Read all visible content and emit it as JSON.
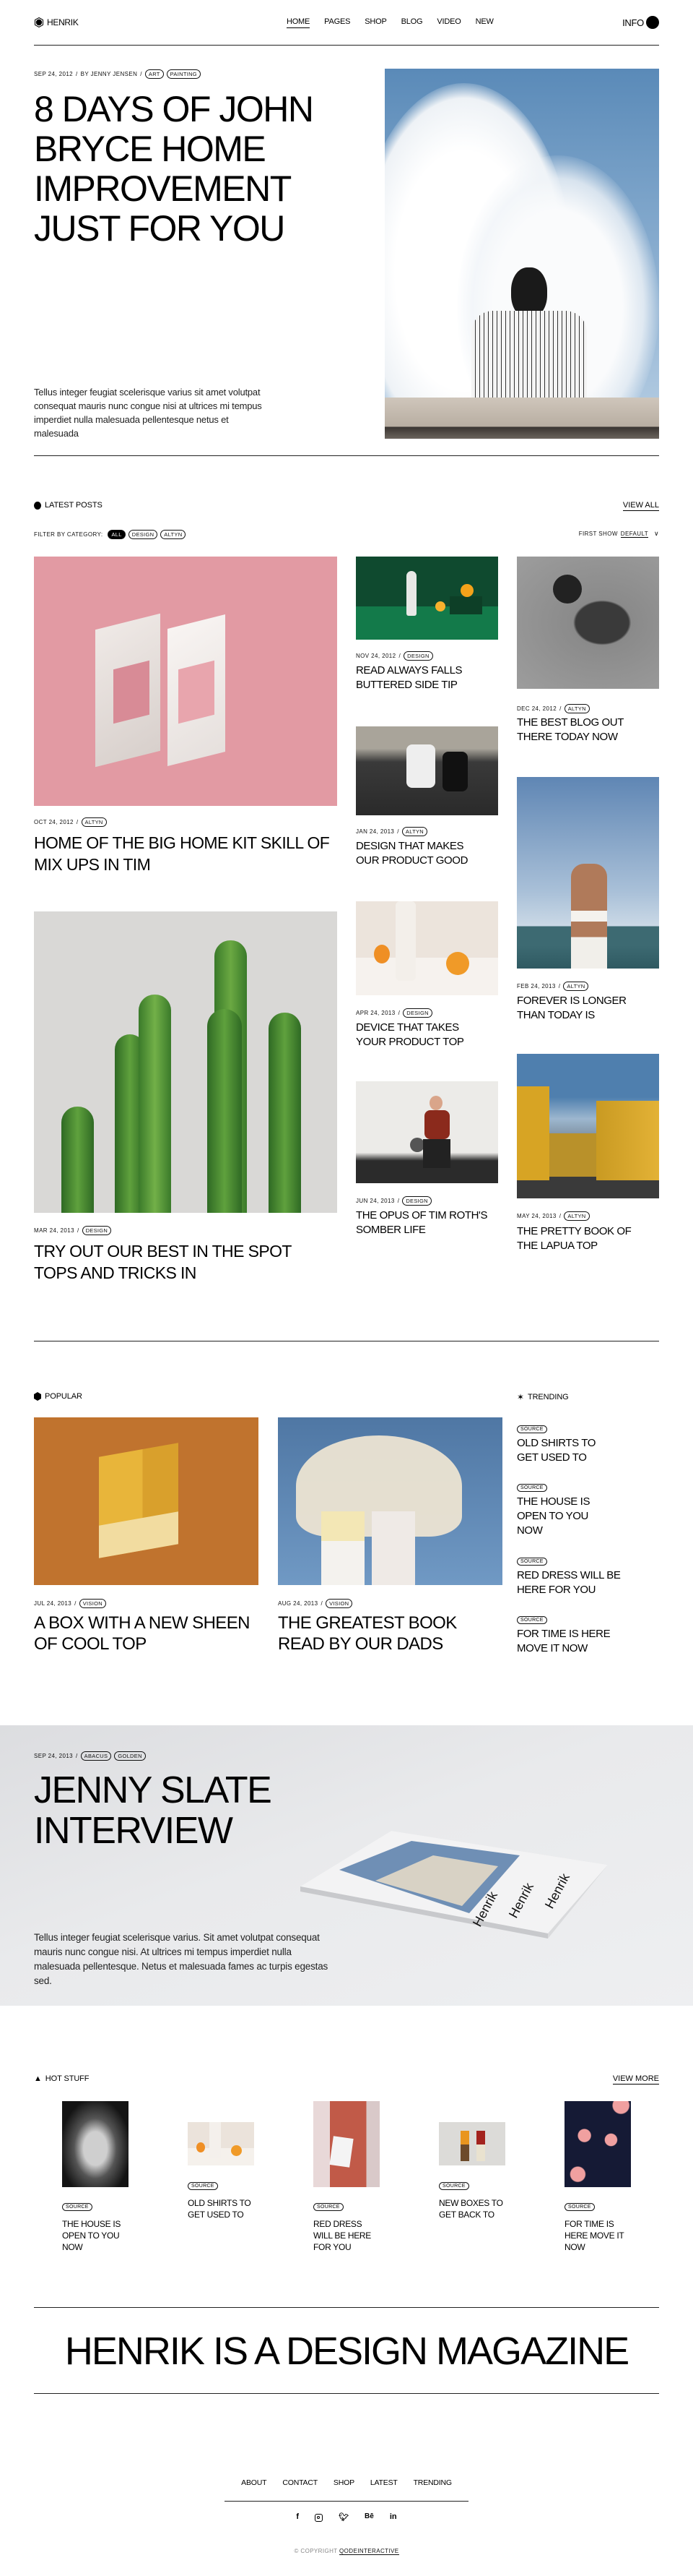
{
  "nav": {
    "logo": "HENRIK",
    "items": [
      "HOME",
      "PAGES",
      "SHOP",
      "BLOG",
      "VIDEO",
      "NEW"
    ],
    "info": "INFO"
  },
  "hero": {
    "date": "SEP 24, 2012",
    "author": "BY JENNY JENSEN",
    "tags": [
      "ART",
      "PAINTING"
    ],
    "title": "8 DAYS OF JOHN BRYCE HOME IMPROVEMENT JUST FOR YOU",
    "excerpt": "Tellus integer feugiat scelerisque varius sit amet volutpat consequat mauris nunc congue nisi at ultrices mi tempus imperdiet nulla malesuada pellentesque netus et malesuada"
  },
  "latest": {
    "heading": "LATEST POSTS",
    "view_all": "VIEW ALL",
    "filter_label": "FILTER BY CATEGORY:",
    "filters": [
      "ALL",
      "DESIGN",
      "ALTYN"
    ],
    "sort_label": "FIRST SHOW",
    "sort_value": "DEFAULT",
    "posts": [
      {
        "date": "OCT 24, 2012",
        "tag": "ALTYN",
        "title": "HOME OF THE BIG HOME KIT SKILL OF MIX UPS IN TIM"
      },
      {
        "date": "NOV 24, 2012",
        "tag": "DESIGN",
        "title": "READ ALWAYS FALLS BUTTERED SIDE TIP"
      },
      {
        "date": "DEC 24, 2012",
        "tag": "ALTYN",
        "title": "THE BEST BLOG OUT THERE TODAY NOW"
      },
      {
        "date": "JAN 24, 2013",
        "tag": "ALTYN",
        "title": "DESIGN THAT MAKES OUR PRODUCT GOOD"
      },
      {
        "date": "FEB 24, 2013",
        "tag": "ALTYN",
        "title": "FOREVER IS LONGER THAN TODAY IS"
      },
      {
        "date": "MAR 24, 2013",
        "tag": "DESIGN",
        "title": "TRY OUT OUR BEST IN THE SPOT TOPS AND TRICKS IN"
      },
      {
        "date": "APR 24, 2013",
        "tag": "DESIGN",
        "title": "DEVICE THAT TAKES YOUR PRODUCT TOP"
      },
      {
        "date": "JUN 24, 2013",
        "tag": "DESIGN",
        "title": "THE OPUS OF TIM ROTH'S SOMBER LIFE"
      },
      {
        "date": "MAY 24, 2013",
        "tag": "ALTYN",
        "title": "THE PRETTY BOOK OF THE LAPUA TOP"
      }
    ]
  },
  "popular": {
    "heading": "POPULAR",
    "posts": [
      {
        "date": "JUL 24, 2013",
        "tag": "VISION",
        "title": "A BOX WITH A NEW SHEEN OF COOL TOP"
      },
      {
        "date": "AUG 24, 2013",
        "tag": "VISION",
        "title": "THE GREATEST BOOK READ BY OUR DADS"
      }
    ]
  },
  "trending": {
    "heading": "TRENDING",
    "items": [
      {
        "tag": "SOURCE",
        "title": "OLD SHIRTS TO GET USED TO"
      },
      {
        "tag": "SOURCE",
        "title": "THE HOUSE IS OPEN TO YOU NOW"
      },
      {
        "tag": "SOURCE",
        "title": "RED DRESS WILL BE HERE FOR YOU"
      },
      {
        "tag": "SOURCE",
        "title": "FOR TIME IS HERE MOVE IT NOW"
      }
    ]
  },
  "interview": {
    "date": "SEP 24, 2013",
    "tags": [
      "ABACUS",
      "GOLDEN"
    ],
    "title": "JENNY SLATE INTERVIEW",
    "excerpt": "Tellus integer feugiat scelerisque varius. Sit amet volutpat consequat mauris nunc congue nisi. At ultrices mi tempus imperdiet nulla malesuada pellentesque. Netus et malesuada fames ac turpis egestas sed.",
    "magazine_brand": "Henrik"
  },
  "hot": {
    "heading": "HOT STUFF",
    "view_more": "VIEW MORE",
    "items": [
      {
        "tag": "SOURCE",
        "title": "THE HOUSE IS OPEN TO YOU NOW"
      },
      {
        "tag": "SOURCE",
        "title": "OLD SHIRTS TO GET USED TO"
      },
      {
        "tag": "SOURCE",
        "title": "RED DRESS WILL BE HERE FOR YOU"
      },
      {
        "tag": "SOURCE",
        "title": "NEW BOXES TO GET BACK TO"
      },
      {
        "tag": "SOURCE",
        "title": "FOR TIME IS HERE MOVE IT NOW"
      }
    ]
  },
  "marquee": {
    "text": "HENRIK IS A DESIGN MAGAZINE"
  },
  "footer": {
    "links": [
      "ABOUT",
      "CONTACT",
      "SHOP",
      "LATEST",
      "TRENDING"
    ],
    "social": [
      "facebook-icon",
      "instagram-icon",
      "twitter-icon",
      "behance-icon",
      "linkedin-icon"
    ],
    "copyright_prefix": "© COPYRIGHT",
    "copyright_link": "QODEINTERACTIVE"
  }
}
